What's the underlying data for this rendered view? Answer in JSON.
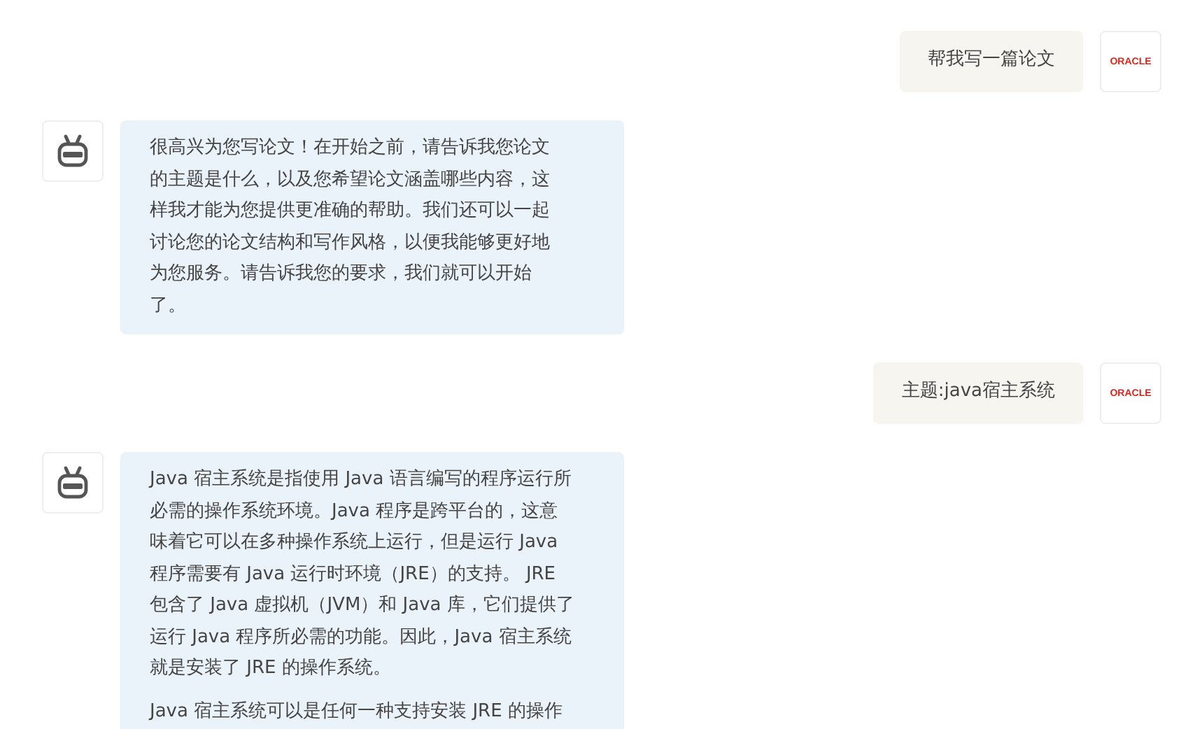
{
  "messages": [
    {
      "kind": "user",
      "avatar_text": "ORACLE",
      "paragraphs": [
        [
          "帮我写一篇论文"
        ]
      ]
    },
    {
      "kind": "bot",
      "paragraphs": [
        [
          "很高兴为您写论文！在开始之前，请告诉我您论文",
          "的主题是什么，以及您希望论文涵盖哪些内容，这",
          "样我才能为您提供更准确的帮助。我们还可以一起",
          "讨论您的论文结构和写作风格，以便我能够更好地",
          "为您服务。请告诉我您的要求，我们就可以开始",
          "了。"
        ]
      ]
    },
    {
      "kind": "user",
      "avatar_text": "ORACLE",
      "paragraphs": [
        [
          "主题:java宿主系统"
        ]
      ]
    },
    {
      "kind": "bot",
      "paragraphs": [
        [
          "Java 宿主系统是指使用 Java 语言编写的程序运行所",
          "必需的操作系统环境。Java 程序是跨平台的，这意",
          "味着它可以在多种操作系统上运行，但是运行 Java",
          "程序需要有 Java 运行时环境（JRE）的支持。 JRE",
          "包含了 Java 虚拟机（JVM）和 Java 库，它们提供了",
          "运行 Java 程序所必需的功能。因此，Java 宿主系统",
          "就是安装了 JRE 的操作系统。"
        ],
        [
          "Java 宿主系统可以是任何一种支持安装 JRE 的操作"
        ]
      ]
    }
  ]
}
